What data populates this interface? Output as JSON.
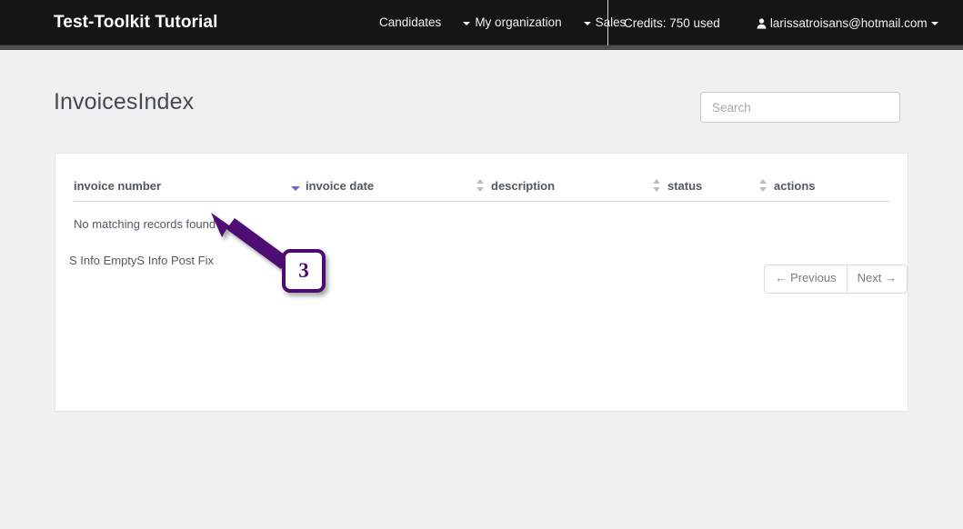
{
  "navbar": {
    "brand": "Test-Toolkit Tutorial",
    "links": [
      {
        "label": "Candidates",
        "has_caret": false
      },
      {
        "label": "My organization",
        "has_caret": true
      },
      {
        "label": "Sales",
        "has_caret": true
      }
    ],
    "credits": "Credits: 750 used",
    "user_email": "larissatroisans@hotmail.com",
    "user_icon": "person-icon",
    "user_caret_icon": "caret-down-icon",
    "background_color": "#151515"
  },
  "page": {
    "title": "InvoicesIndex"
  },
  "search": {
    "placeholder": "Search",
    "value": "",
    "icon": "search-input"
  },
  "table": {
    "columns": [
      {
        "label": "invoice number",
        "sort": "desc",
        "sort_icon": "sort-desc-icon"
      },
      {
        "label": "invoice date",
        "sort": "none",
        "sort_icon": "sort-both-icon"
      },
      {
        "label": "description",
        "sort": "none",
        "sort_icon": "sort-both-icon"
      },
      {
        "label": "status",
        "sort": "none",
        "sort_icon": "sort-both-icon"
      },
      {
        "label": "actions",
        "sort": "none",
        "sort_icon": "sort-both-icon"
      }
    ],
    "empty_message": "No matching records found",
    "info_text": "S Info EmptyS Info Post Fix",
    "rows": []
  },
  "pagination": {
    "previous_label": "← Previous",
    "next_label": "Next →"
  },
  "annotation": {
    "badge_number": "3",
    "color": "#4e0a73"
  }
}
